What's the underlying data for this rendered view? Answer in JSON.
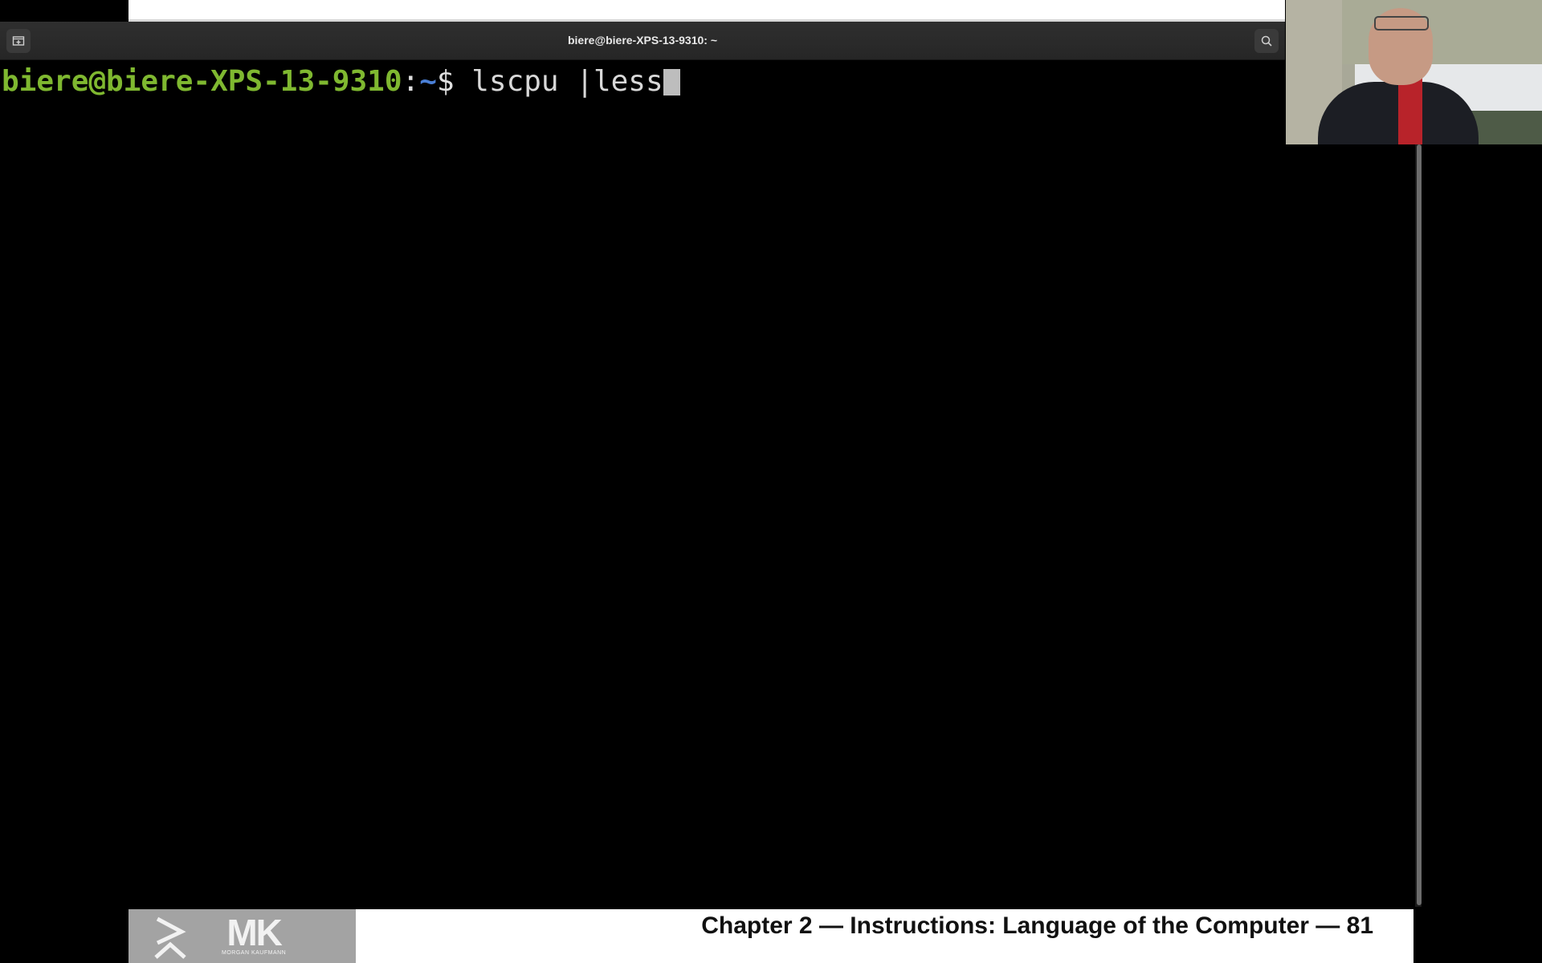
{
  "terminal": {
    "title": "biere@biere-XPS-13-9310: ~",
    "prompt": {
      "user_host": "biere@biere-XPS-13-9310",
      "colon": ":",
      "path": "~",
      "dollar": "$",
      "command": " lscpu |less"
    },
    "colors": {
      "background": "#000000",
      "user_host": "#7fb830",
      "path": "#4a7fd6",
      "text": "#d8d8d8"
    },
    "icons": {
      "new_tab": "new-tab-icon",
      "search": "search-icon"
    }
  },
  "slide": {
    "footer_title": "Chapter 2 — Instructions: Language of the Computer — 81",
    "logo": {
      "letters": "MK",
      "subtitle": "MORGAN KAUFMANN"
    }
  }
}
